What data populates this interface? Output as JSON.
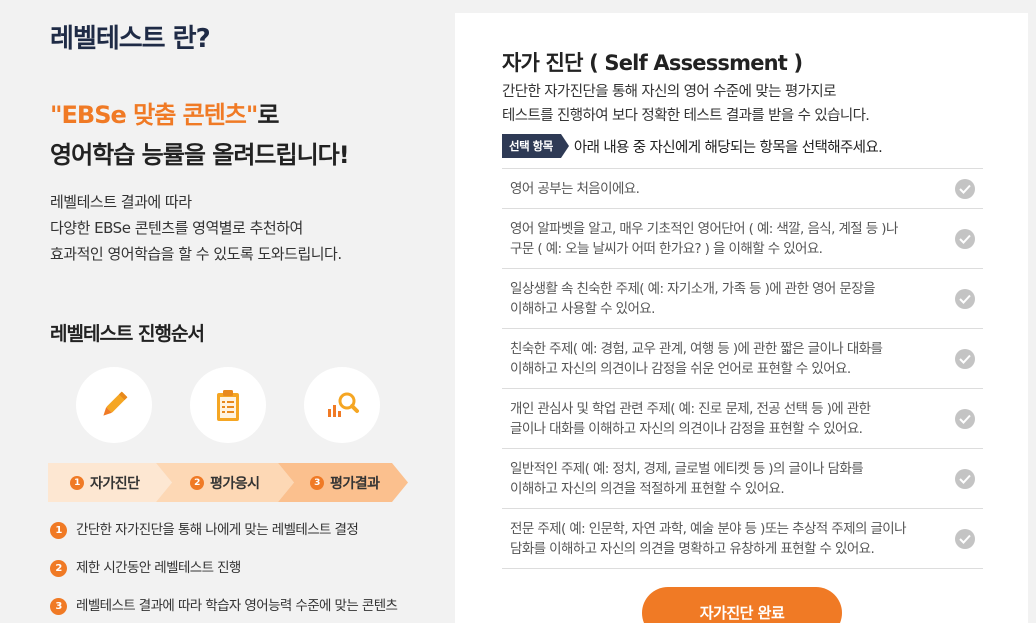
{
  "intro": {
    "title": "레벨테스트 란?",
    "headline_accent": "\"EBSe 맞춤 콘텐츠\"",
    "headline_rest": "로",
    "headline_line2": "영어학습 능률을 올려드립니다!",
    "desc": [
      "레벨테스트 결과에 따라",
      "다양한 EBSe 콘텐츠를 영역별로 추천하여",
      "효과적인 영어학습을 할 수 있도록 도와드립니다."
    ]
  },
  "steps": {
    "title": "레벨테스트 진행순서",
    "icons": [
      "pencil-icon",
      "clipboard-icon",
      "chart-search-icon"
    ],
    "labels": [
      {
        "num": "1",
        "label": "자가진단"
      },
      {
        "num": "2",
        "label": "평가응시"
      },
      {
        "num": "3",
        "label": "평가결과"
      }
    ],
    "process": [
      {
        "num": "1",
        "text": "간단한 자가진단을 통해 나에게 맞는 레벨테스트 결정"
      },
      {
        "num": "2",
        "text": "제한 시간동안 레벨테스트 진행"
      },
      {
        "num": "3",
        "text": "레벨테스트 결과에 따라 학습자 영어능력 수준에 맞는 콘텐츠"
      }
    ]
  },
  "assessment": {
    "title": "자가 진단 ( Self Assessment )",
    "desc": [
      "간단한 자가진단을 통해 자신의 영어 수준에 맞는 평가지로",
      "테스트를 진행하여 보다 정확한 테스트 결과를 받을 수 있습니다."
    ],
    "select_tag": "선택 항목",
    "select_text": "아래 내용 중 자신에게 해당되는 항목을 선택해주세요.",
    "items": [
      "영어 공부는 처음이에요.",
      "영어 알파벳을 알고, 매우 기초적인 영어단어 ( 예: 색깔, 음식, 계절 등 )나\n구문 ( 예: 오늘 날씨가 어떠 한가요? ) 을 이해할 수 있어요.",
      "일상생활 속 친숙한 주제( 예: 자기소개, 가족 등 )에 관한 영어 문장을\n이해하고 사용할 수 있어요.",
      "친숙한 주제( 예: 경험, 교우 관계, 여행 등 )에 관한 짧은 글이나 대화를\n이해하고 자신의 의견이나 감정을 쉬운 언어로 표현할 수 있어요.",
      "개인 관심사 및 학업 관련 주제( 예: 진로 문제, 전공 선택 등 )에 관한\n글이나 대화를 이해하고 자신의 의견이나 감정을 표현할 수 있어요.",
      "일반적인 주제( 예: 정치, 경제, 글로벌 에티켓 등 )의 글이나 담화를\n이해하고 자신의 의견을 적절하게 표현할 수 있어요.",
      "전문 주제( 예: 인문학, 자연 과학, 예술 분야 등 )또는 추상적 주제의 글이나\n담화를 이해하고 자신의 의견을 명확하고 유창하게 표현할 수 있어요."
    ],
    "submit_label": "자가진단 완료"
  },
  "colors": {
    "accent": "#f07a25",
    "navy": "#1f2b46",
    "check": "#c4c4c4"
  }
}
